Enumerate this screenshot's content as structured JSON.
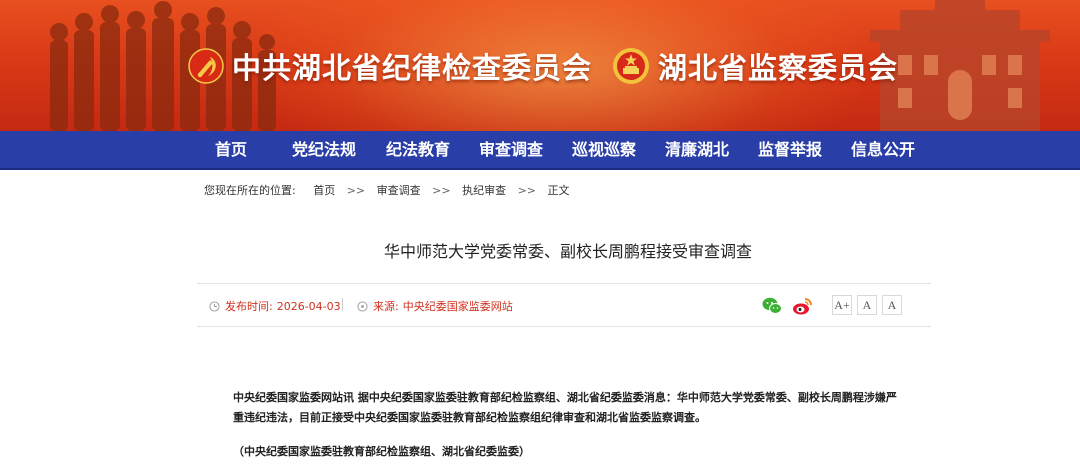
{
  "header": {
    "title_party": "中共湖北省纪律检查委员会",
    "title_gov": "湖北省监察委员会"
  },
  "nav": {
    "items": [
      {
        "label": "首页"
      },
      {
        "label": "党纪法规"
      },
      {
        "label": "纪法教育"
      },
      {
        "label": "审查调查"
      },
      {
        "label": "巡视巡察"
      },
      {
        "label": "清廉湖北"
      },
      {
        "label": "监督举报"
      },
      {
        "label": "信息公开"
      }
    ]
  },
  "breadcrumb": {
    "prefix": "您现在所在的位置:",
    "items": [
      "首页",
      "审查调查",
      "执纪审查",
      "正文"
    ],
    "separator": ">>"
  },
  "article": {
    "title": "华中师范大学党委常委、副校长周鹏程接受审查调查",
    "publish_label": "发布时间:",
    "publish_date": "2026-04-03",
    "source_label": "来源:",
    "source": "中央纪委国家监委网站",
    "paragraph": "中央纪委国家监委网站讯  据中央纪委国家监委驻教育部纪检监察组、湖北省纪委监委消息：华中师范大学党委常委、副校长周鹏程涉嫌严重违纪违法，目前正接受中央纪委国家监委驻教育部纪检监察组纪律审查和湖北省监委监察调查。",
    "signature": "（中央纪委国家监委驻教育部纪检监察组、湖北省纪委监委）"
  },
  "font_buttons": [
    "A+",
    "A",
    "A"
  ],
  "colors": {
    "banner_red": "#d93a17",
    "nav_blue": "#2a3ea8",
    "meta_red": "#d0301e",
    "wechat_green": "#3cb034",
    "weibo_orange": "#f08a24"
  }
}
